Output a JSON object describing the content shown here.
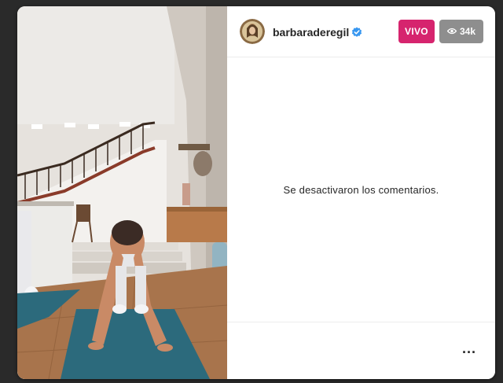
{
  "header": {
    "username": "barbaraderegil",
    "verified": true,
    "live_label": "VIVO",
    "viewer_count": "34k",
    "viewer_icon": "eye-icon"
  },
  "comments": {
    "disabled_message": "Se desactivaron los comentarios."
  },
  "footer": {
    "more_icon": "more-options-icon",
    "more_glyph": "···"
  },
  "colors": {
    "live_badge": "#d6246e",
    "viewer_badge": "#8e8e8e",
    "verified_badge": "#3897f0",
    "yoga_mat": "#2c6a7c"
  }
}
